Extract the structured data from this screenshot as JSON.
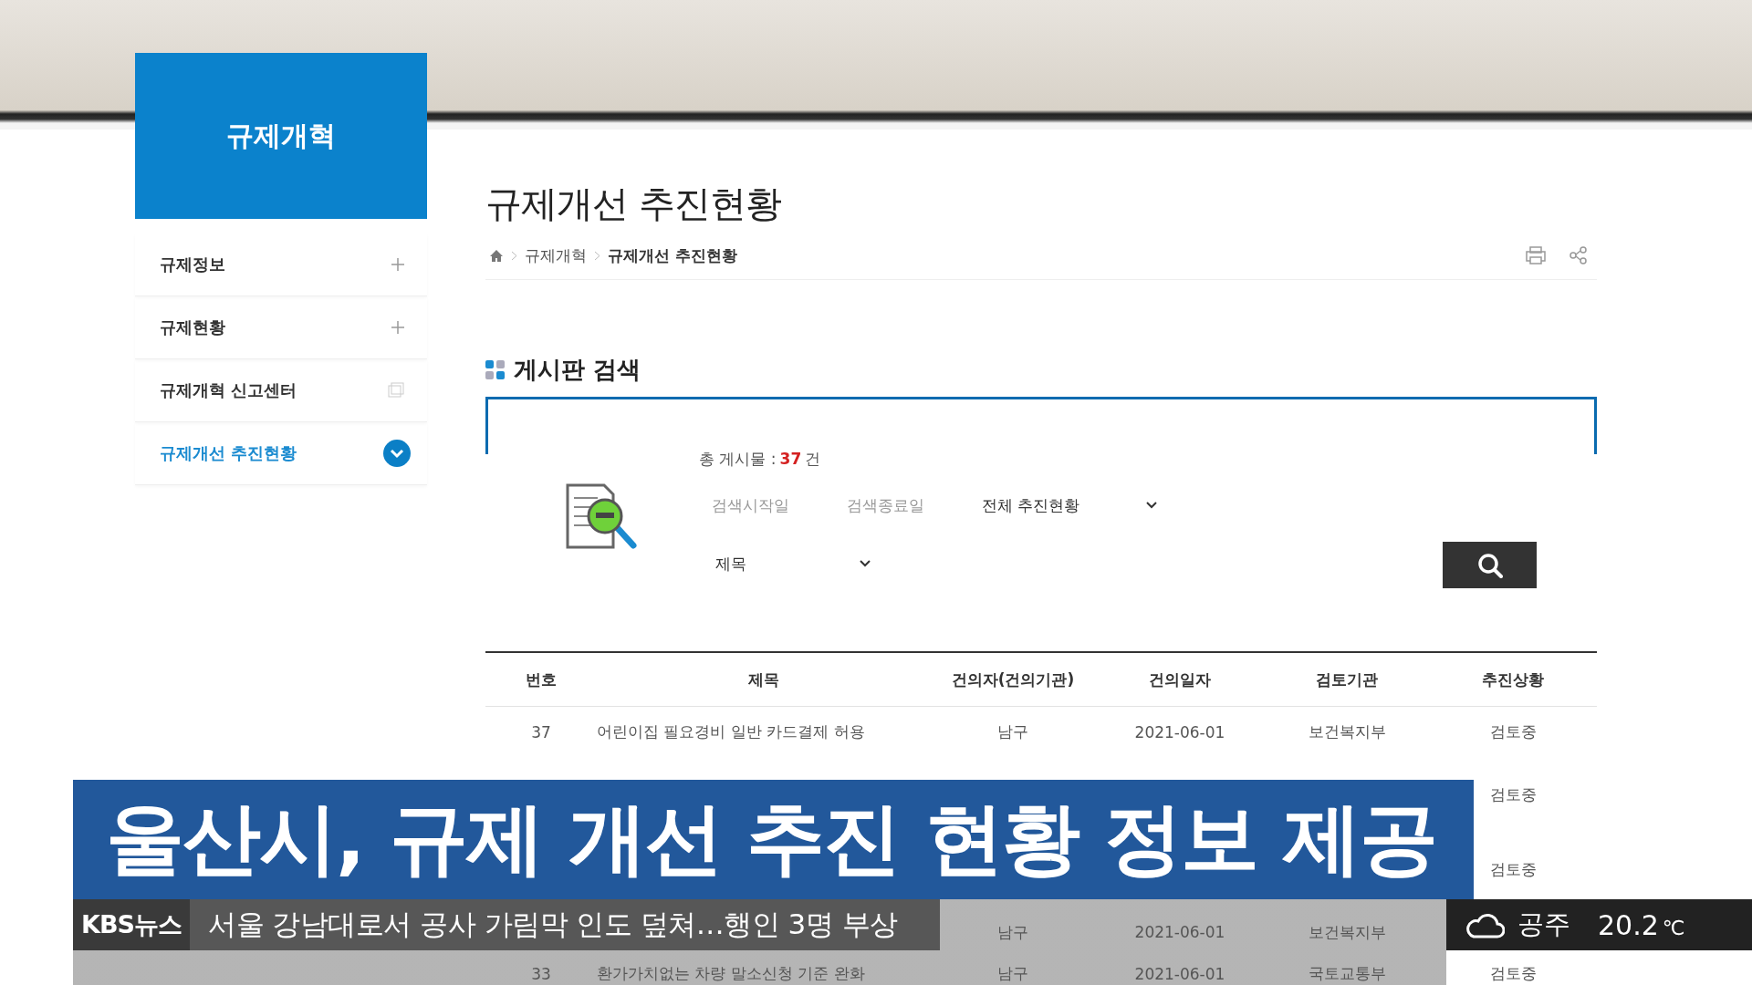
{
  "sidebar": {
    "title": "규제개혁",
    "items": [
      {
        "label": "규제정보",
        "kind": "expand",
        "selected": false
      },
      {
        "label": "규제현황",
        "kind": "expand",
        "selected": false
      },
      {
        "label": "규제개혁 신고센터",
        "kind": "link",
        "selected": false
      },
      {
        "label": "규제개선 추진현황",
        "kind": "expand",
        "selected": true
      }
    ]
  },
  "page": {
    "title": "규제개선 추진현황",
    "breadcrumb": [
      "규제개혁",
      "규제개선 추진현황"
    ]
  },
  "search": {
    "heading": "게시판 검색",
    "total_label": "총 게시물 : ",
    "total_count": "37",
    "total_unit": "건",
    "start_date": {
      "placeholder": "검색시작일"
    },
    "end_date": {
      "placeholder": "검색종료일"
    },
    "status_select": "전체 추진현황",
    "field_select": "제목"
  },
  "table": {
    "columns": [
      "번호",
      "제목",
      "건의자(건의기관)",
      "건의일자",
      "검토기관",
      "추진상황"
    ],
    "rows": [
      {
        "number": "37",
        "title": "어린이집 필요경비 일반 카드결제 허용",
        "proposer": "남구",
        "date": "2021-06-01",
        "agency": "보건복지부",
        "status": "검토중"
      },
      {
        "status": "검토중"
      },
      {
        "status": "검토중"
      },
      {
        "proposer": "남구",
        "date": "2021-06-01",
        "agency": "보건복지부"
      },
      {
        "number": "33",
        "title": "환가가치없는 차량 말소신청 기준 완화",
        "proposer": "남구",
        "date": "2021-06-01",
        "agency": "국토교통부",
        "status": "검토중"
      }
    ]
  },
  "headline": "울산시, 규제 개선 추진 현황 정보 제공",
  "ticker": {
    "logo": "KBS뉴스",
    "text": "서울 강남대로서 공사 가림막 인도 덮쳐…행인 3명 부상"
  },
  "weather": {
    "city": "공주",
    "temperature": "20.2",
    "unit": "℃"
  }
}
